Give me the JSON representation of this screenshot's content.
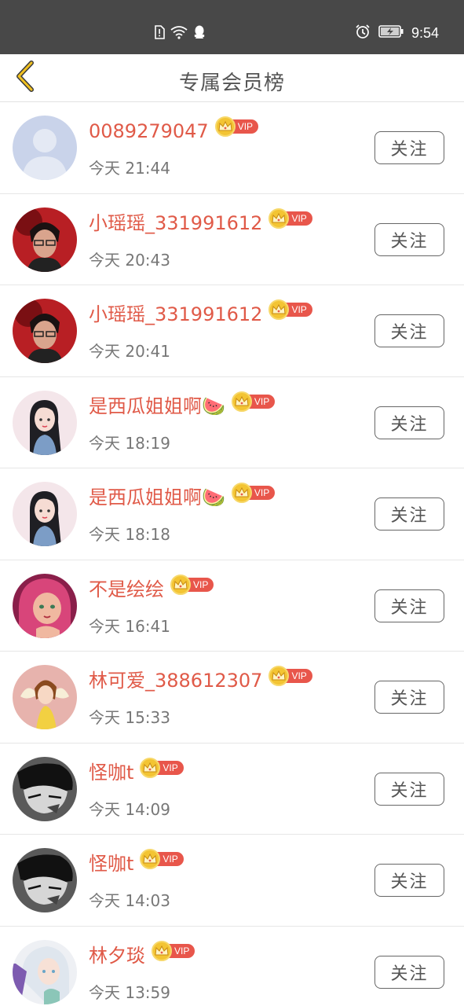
{
  "status_bar": {
    "time": "9:54",
    "icons": [
      "sim-alert-icon",
      "wifi-icon",
      "qq-icon",
      "alarm-icon",
      "battery-charging-icon"
    ]
  },
  "header": {
    "title": "专属会员榜",
    "back_icon": "chevron-left-icon",
    "accent_color": "#f0c020"
  },
  "vip_badge_label": "VIP",
  "follow_label": "关注",
  "members": [
    {
      "name": "0089279047",
      "time": "今天 21:44",
      "avatar": "default-avatar"
    },
    {
      "name": "小瑶瑶_331991612",
      "time": "今天 20:43",
      "avatar": "male-dark-red-avatar"
    },
    {
      "name": "小瑶瑶_331991612",
      "time": "今天 20:41",
      "avatar": "male-dark-red-avatar"
    },
    {
      "name": "是西瓜姐姐啊🍉",
      "time": "今天 18:19",
      "avatar": "anime-girl-avatar"
    },
    {
      "name": "是西瓜姐姐啊🍉",
      "time": "今天 18:18",
      "avatar": "anime-girl-avatar"
    },
    {
      "name": "不是绘绘",
      "time": "今天 16:41",
      "avatar": "pink-hair-girl-avatar"
    },
    {
      "name": "林可爱_388612307",
      "time": "今天 15:33",
      "avatar": "fairy-girl-avatar"
    },
    {
      "name": "怪咖t",
      "time": "今天 14:09",
      "avatar": "monochrome-boy-avatar"
    },
    {
      "name": "怪咖t",
      "time": "今天 14:03",
      "avatar": "monochrome-boy-avatar"
    },
    {
      "name": "林夕琰",
      "time": "今天 13:59",
      "avatar": "white-hair-girl-avatar"
    }
  ],
  "colors": {
    "name": "#e05a48",
    "vip_badge": "#e8564b",
    "crown": "#f3c433",
    "status_bar": "#484848"
  }
}
